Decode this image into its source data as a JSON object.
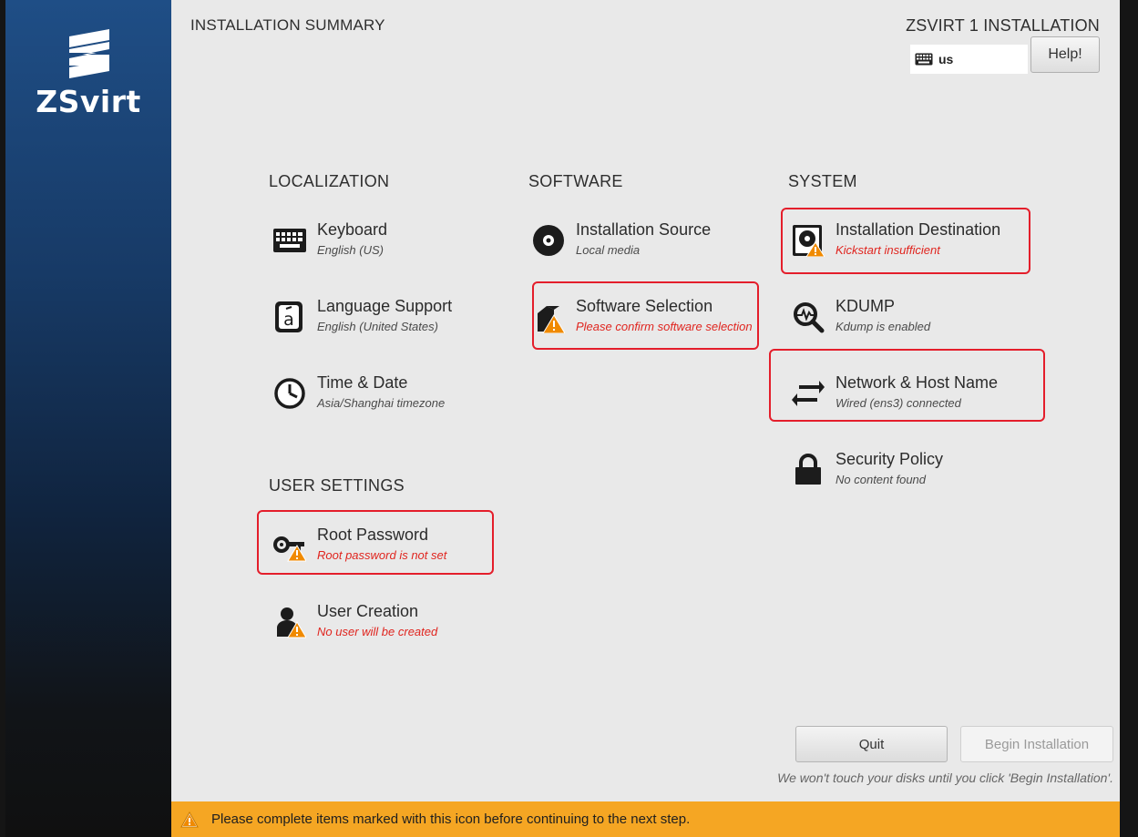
{
  "sidebar": {
    "logo_text": "ZSvirt"
  },
  "header": {
    "title": "INSTALLATION SUMMARY",
    "product": "ZSVIRT 1 INSTALLATION",
    "keyboard_layout": "us",
    "help_label": "Help!"
  },
  "sections": {
    "localization": {
      "title": "LOCALIZATION",
      "items": [
        {
          "name": "Keyboard",
          "status": "English (US)",
          "icon": "keyboard-icon"
        },
        {
          "name": "Language Support",
          "status": "English (United States)",
          "icon": "language-icon"
        },
        {
          "name": "Time & Date",
          "status": "Asia/Shanghai timezone",
          "icon": "clock-icon"
        }
      ]
    },
    "software": {
      "title": "SOFTWARE",
      "items": [
        {
          "name": "Installation Source",
          "status": "Local media",
          "icon": "disc-icon"
        },
        {
          "name": "Software Selection",
          "status": "Please confirm software selection",
          "icon": "package-icon",
          "warning": true
        }
      ]
    },
    "system": {
      "title": "SYSTEM",
      "items": [
        {
          "name": "Installation Destination",
          "status": "Kickstart insufficient",
          "icon": "harddisk-icon",
          "warning": true
        },
        {
          "name": "KDUMP",
          "status": "Kdump is enabled",
          "icon": "kdump-search-icon"
        },
        {
          "name": "Network & Host Name",
          "status": "Wired (ens3) connected",
          "icon": "network-arrows-icon"
        },
        {
          "name": "Security Policy",
          "status": "No content found",
          "icon": "lock-icon"
        }
      ]
    },
    "user_settings": {
      "title": "USER SETTINGS",
      "items": [
        {
          "name": "Root Password",
          "status": "Root password is not set",
          "icon": "key-icon",
          "warning": true
        },
        {
          "name": "User Creation",
          "status": "No user will be created",
          "icon": "user-icon",
          "warning": true
        }
      ]
    }
  },
  "footer": {
    "quit_label": "Quit",
    "begin_label": "Begin Installation",
    "note": "We won't touch your disks until you click 'Begin Installation'.",
    "warning_text": "Please complete items marked with this icon before continuing to the next step."
  },
  "colors": {
    "sidebar_top": "#1f4e86",
    "warning_bar": "#f5a623",
    "warning_text": "#e0251f",
    "highlight_box": "#e41e2b",
    "main_bg": "#e9e9e9"
  }
}
